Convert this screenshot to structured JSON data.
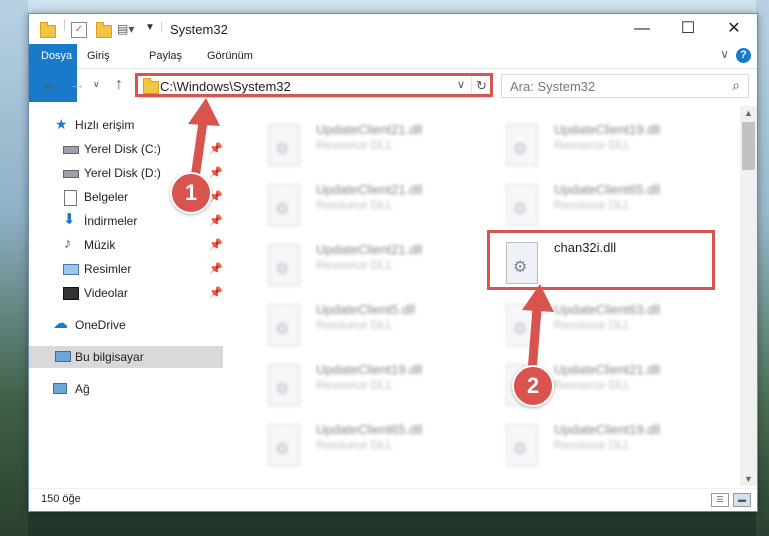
{
  "window": {
    "title": "System32"
  },
  "ribbon": {
    "tabs": [
      "Dosya",
      "Giriş",
      "Paylaş",
      "Görünüm"
    ],
    "help": "?"
  },
  "address": {
    "path": "C:\\Windows\\System32"
  },
  "search": {
    "placeholder": "Ara: System32"
  },
  "nav": {
    "quick_access": "Hızlı erişim",
    "items": [
      {
        "label": "Yerel Disk (C:)",
        "icon": "drive-icon"
      },
      {
        "label": "Yerel Disk (D:)",
        "icon": "drive-icon"
      },
      {
        "label": "Belgeler",
        "icon": "documents-icon"
      },
      {
        "label": "İndirmeler",
        "icon": "download-icon"
      },
      {
        "label": "Müzik",
        "icon": "music-icon"
      },
      {
        "label": "Resimler",
        "icon": "pictures-icon"
      },
      {
        "label": "Videolar",
        "icon": "videos-icon"
      }
    ],
    "onedrive": "OneDrive",
    "this_pc": "Bu bilgisayar",
    "network": "Ağ"
  },
  "files": {
    "left": [
      {
        "name": "UpdateClient21.dll",
        "desc": "Resource DLL"
      },
      {
        "name": "UpdateClient21.dll",
        "desc": "Resource DLL"
      },
      {
        "name": "UpdateClient21.dll",
        "desc": "Resource DLL"
      },
      {
        "name": "UpdateClient5.dll",
        "desc": "Resource DLL"
      },
      {
        "name": "UpdateClient19.dll",
        "desc": "Resource DLL"
      },
      {
        "name": "UpdateClient65.dll",
        "desc": "Resource DLL"
      }
    ],
    "right": [
      {
        "name": "UpdateClient19.dll",
        "desc": "Resource DLL"
      },
      {
        "name": "UpdateClient65.dll",
        "desc": "Resource DLL"
      },
      {
        "name": "chan32i.dll",
        "desc": ""
      },
      {
        "name": "UpdateClient63.dll",
        "desc": "Resource DLL"
      },
      {
        "name": "UpdateClient21.dll",
        "desc": "Resource DLL"
      },
      {
        "name": "UpdateClient19.dll",
        "desc": "Resource DLL"
      }
    ]
  },
  "status": {
    "count": "150 öğe"
  },
  "markers": {
    "one": "1",
    "two": "2"
  },
  "colors": {
    "accent": "#1979ca",
    "highlight": "#d9534f"
  }
}
